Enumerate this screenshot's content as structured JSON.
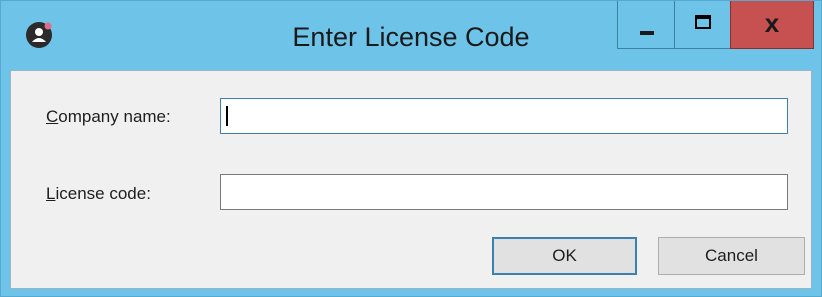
{
  "window": {
    "title": "Enter License Code",
    "app_icon": "user-circle-icon",
    "controls": {
      "minimize": "minimize-icon",
      "maximize": "maximize-icon",
      "close_label": "x"
    },
    "colors": {
      "titlebar": "#6ec3e8",
      "close_button": "#c75050",
      "client_background": "#f0f0f0"
    }
  },
  "form": {
    "company": {
      "label_access_key": "C",
      "label_rest": "ompany name:",
      "value": ""
    },
    "license": {
      "label_access_key": "L",
      "label_rest": "icense code:",
      "value": ""
    }
  },
  "buttons": {
    "ok_label": "OK",
    "cancel_label": "Cancel"
  }
}
